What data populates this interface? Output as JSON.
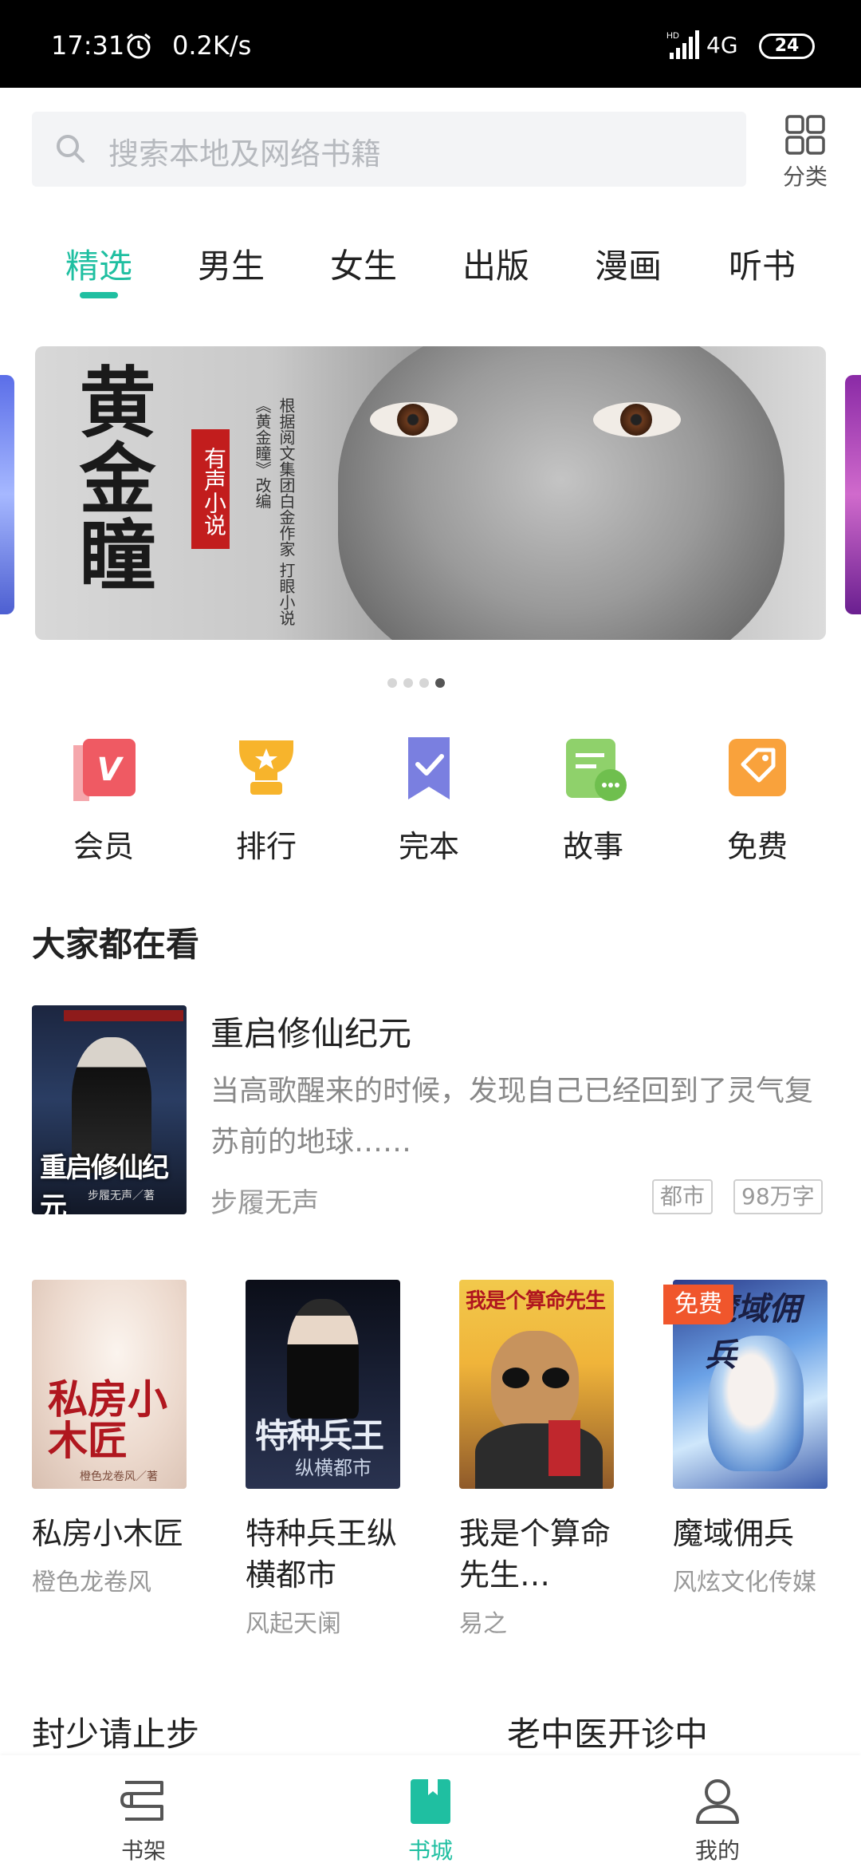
{
  "status_bar": {
    "time": "17:31",
    "speed": "0.2K/s",
    "network": "4G",
    "battery": "24",
    "icons": [
      "alarm-icon",
      "signal-icon",
      "battery-icon"
    ]
  },
  "search": {
    "placeholder": "搜索本地及网络书籍",
    "category_label": "分类"
  },
  "tabs": [
    {
      "label": "精选",
      "active": true
    },
    {
      "label": "男生",
      "active": false
    },
    {
      "label": "女生",
      "active": false
    },
    {
      "label": "出版",
      "active": false
    },
    {
      "label": "漫画",
      "active": false
    },
    {
      "label": "听书",
      "active": false
    }
  ],
  "banner": {
    "title": "黄金瞳",
    "tag": "有声小说",
    "subtitle": "根据阅文集团白金作家 打眼小说《黄金瞳》改编",
    "dots": 4,
    "active_dot": 3
  },
  "quick_links": [
    {
      "label": "会员",
      "icon": "vip-icon",
      "color": "#ef5a63"
    },
    {
      "label": "排行",
      "icon": "trophy-icon",
      "color": "#f7b42c"
    },
    {
      "label": "完本",
      "icon": "bookmark-check-icon",
      "color": "#7a7fe0"
    },
    {
      "label": "故事",
      "icon": "story-chat-icon",
      "color": "#8fd16b"
    },
    {
      "label": "免费",
      "icon": "tag-icon",
      "color": "#f9a23c"
    }
  ],
  "section": {
    "title": "大家都在看"
  },
  "featured": {
    "title": "重启修仙纪元",
    "description": "当高歌醒来的时候，发现自己已经回到了灵气复苏前的地球……",
    "author": "步履无声",
    "tags": [
      "都市",
      "98万字"
    ],
    "cover_text": "重启修仙纪元",
    "cover_author": "步履无声／著"
  },
  "books": [
    {
      "title": "私房小木匠",
      "author": "橙色龙卷风",
      "cover_text": "私房小木匠",
      "cover_sub": "橙色龙卷风／著"
    },
    {
      "title": "特种兵王纵横都市",
      "author": "风起天阑",
      "cover_text": "特种兵王",
      "cover_sub": "纵横都市"
    },
    {
      "title": "我是个算命先生…",
      "author": "易之",
      "cover_text": "我是个算命先生"
    },
    {
      "title": "魔域佣兵",
      "author": "风炫文化传媒",
      "cover_text": "魔域佣兵",
      "badge": "免费"
    }
  ],
  "teasers": [
    "封少请止步",
    "老中医开诊中"
  ],
  "bottom_nav": [
    {
      "label": "书架",
      "icon": "bookshelf-icon",
      "active": false
    },
    {
      "label": "书城",
      "icon": "bookstore-icon",
      "active": true
    },
    {
      "label": "我的",
      "icon": "profile-icon",
      "active": false
    }
  ],
  "colors": {
    "accent": "#1fbfa1",
    "free_badge": "#f0562c"
  }
}
